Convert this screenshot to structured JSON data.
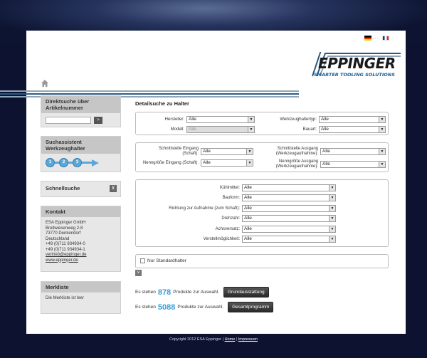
{
  "header": {
    "lang_separator": "....",
    "logo_name": "EPPINGER",
    "logo_tagline": "SMARTER TOOLING SOLUTIONS"
  },
  "sidebar": {
    "search_title": "Direktsuche über Artikelnummer",
    "search_go": ">",
    "assistant_title": "Suchassistent Werkzeughalter",
    "assistant_steps": [
      "1",
      "2",
      "3"
    ],
    "quick_title": "Schnellsuche",
    "contact_title": "Kontakt",
    "contact_lines": [
      "ESA Eppinger GmbH",
      "Breitwiesenweg 2-8",
      "73770 Denkendorf",
      "Deutschland",
      "+49 (0)711 934934-0",
      "+49 (0)711 934934-1"
    ],
    "contact_email": "vertrieb@eppinger.de",
    "contact_web": "www.eppinger.de",
    "wishlist_title": "Merkliste",
    "wishlist_text": "Die Merkliste ist leer"
  },
  "main": {
    "title": "Detailsuche zu Halter",
    "panel1": {
      "hersteller_label": "Hersteller:",
      "hersteller_value": "Alle",
      "modell_label": "Modell:",
      "modell_value": "Alle",
      "typ_label": "Werkzeughaltertyp:",
      "typ_value": "Alle",
      "bauart_label": "Bauart:",
      "bauart_value": "Alle"
    },
    "panel2": {
      "eingang_label": "Schnittstelle Eingang (Schaft):",
      "eingang_value": "Alle",
      "nenn_eingang_label": "Nenngröße Eingang (Schaft):",
      "nenn_eingang_value": "Alle",
      "ausgang_label": "Schnittstelle Ausgang (Werkzeugaufnahme):",
      "ausgang_value": "Alle",
      "nenn_ausgang_label": "Nenngröße Ausgang (Werkzeugaufnahme):",
      "nenn_ausgang_value": "Alle"
    },
    "panel3": [
      {
        "label": "Kühlmittel:",
        "value": "Alle"
      },
      {
        "label": "Bauform:",
        "value": "Alle"
      },
      {
        "label": "Richtung zur Aufnahme (zum Schaft):",
        "value": "Alle"
      },
      {
        "label": "Drehzahl:",
        "value": "Alle"
      },
      {
        "label": "Achsversatz:",
        "value": "Alle"
      },
      {
        "label": "Verstellmöglichkeit:",
        "value": "Alle"
      }
    ],
    "standard_only": "Nur Standardhalter",
    "toggle_symbol": "v",
    "result1": {
      "prefix": "Es stehen",
      "count": "878",
      "suffix": "Produkte zur Auswahl.",
      "button": "Grundausstattung"
    },
    "result2": {
      "prefix": "Es stehen",
      "count": "5088",
      "suffix": "Produkte zur Auswahl.",
      "button": "Gesamtprogramm"
    }
  },
  "footer": {
    "copyright": "Copyright 2012 ESA Eppinger |",
    "home": "Home",
    "sep": "|",
    "impressum": "Impressum"
  },
  "colors": {
    "accent": "#3a9fd6",
    "background": "#0c1230",
    "brand_blue": "#1a5f96"
  },
  "icons": {
    "home": "home-icon",
    "flags": [
      "flag-de-icon",
      "flag-fr-icon"
    ]
  }
}
